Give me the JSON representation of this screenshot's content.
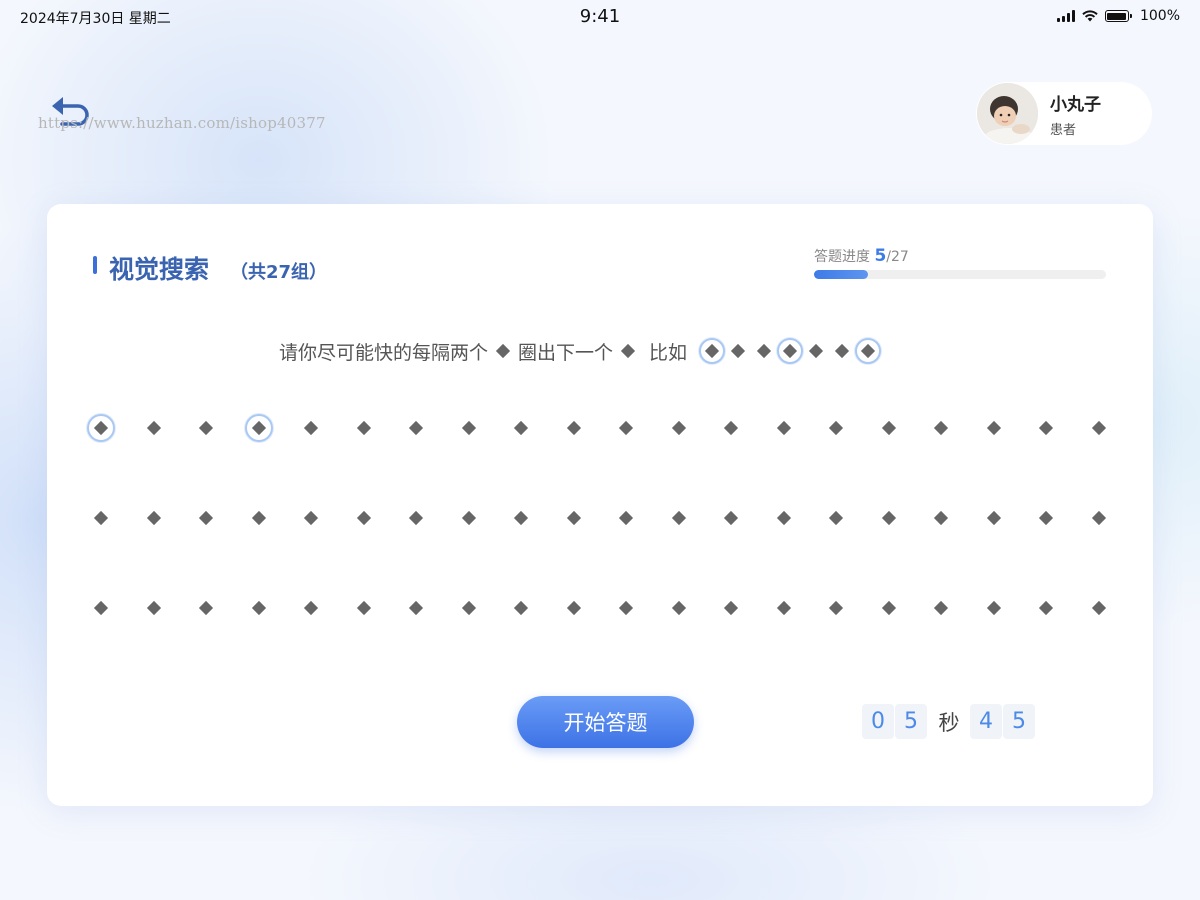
{
  "status": {
    "date": "2024年7月30日 星期二",
    "time": "9:41",
    "battery": "100%"
  },
  "header": {
    "watermark": "https://www.huzhan.com/ishop40377",
    "user": {
      "name": "小丸子",
      "role": "患者"
    }
  },
  "task": {
    "title": "视觉搜索",
    "subtitle": "（共27组）",
    "progress": {
      "label": "答题进度",
      "current": "5",
      "total": "/27",
      "fraction": 0.185
    },
    "instruction": {
      "part1": "请你尽可能快的每隔两个",
      "part2": "圈出下一个",
      "part3": "比如"
    },
    "rows": 3,
    "cols": 20,
    "circled": [
      [
        0,
        0
      ],
      [
        0,
        3
      ]
    ],
    "start_label": "开始答题",
    "timer": {
      "d1": "0",
      "d2": "5",
      "unit": "秒",
      "d3": "4",
      "d4": "5"
    }
  },
  "colors": {
    "accent": "#3d7be6",
    "title": "#3a64b0",
    "diamond": "#666666",
    "circle": "#a9c8f3"
  },
  "icons": {
    "back": "back-arrow-icon",
    "wifi": "wifi-icon",
    "signal": "signal-icon",
    "battery": "battery-icon",
    "diamond": "diamond-icon"
  }
}
